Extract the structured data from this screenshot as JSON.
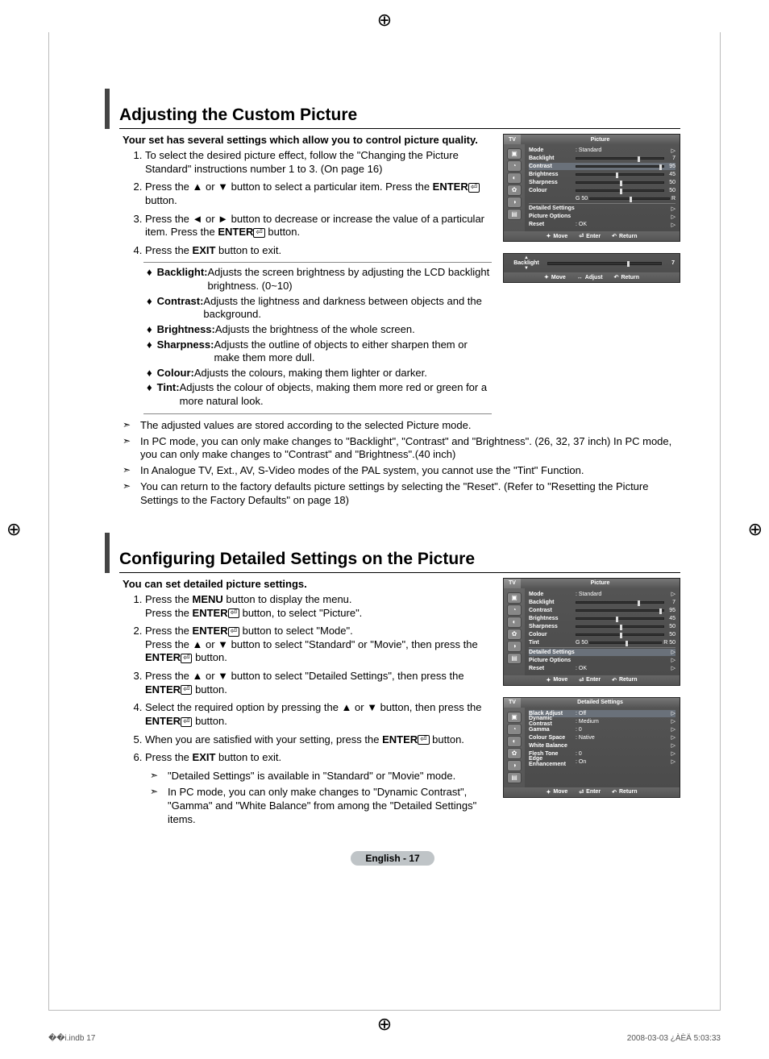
{
  "section1": {
    "title": "Adjusting the Custom Picture",
    "intro": "Your set has several settings which allow you to control picture quality.",
    "steps": [
      {
        "pre": "To select the desired picture effect, follow the \"Changing the Picture Standard\" instructions number 1 to 3. (On page 16)"
      },
      {
        "pre": "Press the ▲ or ▼ button to select a particular item. Press the ",
        "bold": "ENTER",
        "enter": true,
        "post": " button."
      },
      {
        "pre": "Press the ◄ or ► button to decrease or increase the value of a particular item. Press the ",
        "bold": "ENTER",
        "enter": true,
        "post": " button."
      },
      {
        "pre": "Press the ",
        "bold": "EXIT",
        "post": " button to exit."
      }
    ],
    "defs": [
      {
        "term": "Backlight:",
        "desc": " Adjusts the screen brightness by adjusting the LCD backlight brightness. (0~10)"
      },
      {
        "term": "Contrast:",
        "desc": " Adjusts the lightness and darkness between objects and the background."
      },
      {
        "term": "Brightness:",
        "desc": " Adjusts the brightness of the whole screen."
      },
      {
        "term": "Sharpness:",
        "desc": " Adjusts the outline of objects to either sharpen them or make them more dull."
      },
      {
        "term": "Colour:",
        "desc": " Adjusts the colours, making them lighter or darker."
      },
      {
        "term": "Tint:",
        "desc": " Adjusts the colour of objects, making them more red or green for a more natural look."
      }
    ],
    "notes": [
      "The adjusted values are stored according to the selected Picture mode.",
      "In PC mode, you can only make changes to \"Backlight\", \"Contrast\" and \"Brightness\". (26, 32, 37 inch) In PC mode, you can only make changes to \"Contrast\" and \"Brightness\".(40 inch)",
      "In Analogue TV, Ext., AV, S-Video modes of the PAL system, you cannot use the \"Tint\" Function.",
      "You can return to the factory defaults picture settings by selecting the \"Reset\". (Refer to \"Resetting the Picture Settings to the Factory Defaults\" on page 18)"
    ]
  },
  "section2": {
    "title": "Configuring Detailed Settings on the Picture",
    "intro": "You can set detailed picture settings.",
    "steps": [
      {
        "l1": "Press the ",
        "l1b": "MENU",
        "l1p": " button to display the menu.",
        "l2": "Press the ",
        "l2b": "ENTER",
        "l2e": true,
        "l2p": " button, to select \"Picture\"."
      },
      {
        "l1": "Press the ",
        "l1b": "ENTER",
        "l1e": true,
        "l1p": " button to select \"Mode\".",
        "l2": "Press the ▲ or ▼ button to select \"Standard\" or \"Movie\", then press the ",
        "l2b": "ENTER",
        "l2e": true,
        "l2p": " button."
      },
      {
        "l1": "Press the ▲ or ▼ button to select \"Detailed Settings\", then press the ",
        "l1b": "ENTER",
        "l1e": true,
        "l1p": " button."
      },
      {
        "l1": "Select the required option by pressing the ▲ or ▼ button, then press the ",
        "l1b": "ENTER",
        "l1e": true,
        "l1p": " button."
      },
      {
        "l1": "When you are satisfied with your setting, press the ",
        "l1b": "ENTER",
        "l1e": true,
        "l1p": " button."
      },
      {
        "l1": "Press the ",
        "l1b": "EXIT",
        "l1p": " button to exit."
      }
    ],
    "notes": [
      "\"Detailed Settings\" is available in \"Standard\" or \"Movie\" mode.",
      "In PC mode, you can only make changes to \"Dynamic Contrast\", \"Gamma\" and \"White Balance\" from among the \"Detailed Settings\" items."
    ]
  },
  "osd1": {
    "tv": "TV",
    "title": "Picture",
    "rows": [
      {
        "lbl": "Mode",
        "mid": ": Standard",
        "type": "text",
        "arr": "▷"
      },
      {
        "lbl": "Backlight",
        "val": "7",
        "pos": 70,
        "type": "slider"
      },
      {
        "lbl": "Contrast",
        "val": "95",
        "pos": 95,
        "type": "slider",
        "hi": true
      },
      {
        "lbl": "Brightness",
        "val": "45",
        "pos": 45,
        "type": "slider"
      },
      {
        "lbl": "Sharpness",
        "val": "50",
        "pos": 50,
        "type": "slider"
      },
      {
        "lbl": "Colour",
        "val": "50",
        "pos": 50,
        "type": "slider"
      },
      {
        "lbl": "",
        "mid": "G  50",
        "type": "tint",
        "pos": 50,
        "end": "R"
      }
    ],
    "rows2": [
      {
        "lbl": "Detailed Settings",
        "arr": "▷"
      },
      {
        "lbl": "Picture Options",
        "arr": "▷"
      },
      {
        "lbl": "Reset",
        "mid": ": OK",
        "arr": "▷"
      }
    ],
    "footer": {
      "move": "Move",
      "enter": "Enter",
      "return": "Return"
    }
  },
  "osdSlim": {
    "label": "Backlight",
    "val": "7",
    "pos": 70,
    "footer": {
      "move": "Move",
      "adjust": "Adjust",
      "return": "Return"
    }
  },
  "osd2": {
    "tv": "TV",
    "title": "Picture",
    "rows": [
      {
        "lbl": "Mode",
        "mid": ": Standard",
        "type": "text",
        "arr": "▷"
      },
      {
        "lbl": "Backlight",
        "val": "7",
        "pos": 70,
        "type": "slider"
      },
      {
        "lbl": "Contrast",
        "val": "95",
        "pos": 95,
        "type": "slider"
      },
      {
        "lbl": "Brightness",
        "val": "45",
        "pos": 45,
        "type": "slider"
      },
      {
        "lbl": "Sharpness",
        "val": "50",
        "pos": 50,
        "type": "slider"
      },
      {
        "lbl": "Colour",
        "val": "50",
        "pos": 50,
        "type": "slider"
      },
      {
        "lbl": "Tint",
        "mid": "G  50",
        "type": "tint",
        "pos": 50,
        "end": "R  50"
      }
    ],
    "rows2": [
      {
        "lbl": "Detailed Settings",
        "arr": "▷",
        "hi": true
      },
      {
        "lbl": "Picture Options",
        "arr": "▷"
      },
      {
        "lbl": "Reset",
        "mid": ": OK",
        "arr": "▷"
      }
    ],
    "footer": {
      "move": "Move",
      "enter": "Enter",
      "return": "Return"
    }
  },
  "osd3": {
    "tv": "TV",
    "title": "Detailed Settings",
    "rows": [
      {
        "lbl": "Black Adjust",
        "mid": ": Off",
        "arr": "▷",
        "hi": true
      },
      {
        "lbl": "Dynamic Contrast",
        "mid": ": Medium",
        "arr": "▷"
      },
      {
        "lbl": "Gamma",
        "mid": ":   0",
        "arr": "▷"
      },
      {
        "lbl": "Colour Space",
        "mid": ": Native",
        "arr": "▷"
      },
      {
        "lbl": "White Balance",
        "mid": "",
        "arr": "▷"
      },
      {
        "lbl": "Flesh Tone",
        "mid": ":   0",
        "arr": "▷"
      },
      {
        "lbl": "Edge Enhancement",
        "mid": ": On",
        "arr": "▷"
      }
    ],
    "footer": {
      "move": "Move",
      "enter": "Enter",
      "return": "Return"
    }
  },
  "pagefoot": "English - 17",
  "print": {
    "left": "��i.indb   17",
    "right": "2008-03-03   ¿ÀÈÄ 5:03:33"
  }
}
